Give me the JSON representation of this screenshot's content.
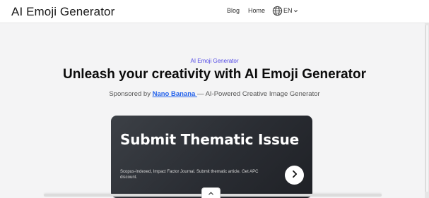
{
  "header": {
    "brand": "AI Emoji Generator",
    "nav": {
      "blog": "Blog",
      "home": "Home"
    },
    "language": {
      "icon": "globe-icon",
      "code": "EN",
      "caret_icon": "chevron-down-icon"
    }
  },
  "hero": {
    "eyebrow": "AI Emoji Generator",
    "headline": "Unleash your creativity with AI Emoji Generator",
    "sponsor": {
      "prefix": "Sponsored by ",
      "link": "Nano Banana ",
      "suffix": "— AI-Powered Creative Image Generator"
    }
  },
  "ad": {
    "title": "Submit Thematic Issue",
    "description": "Scopus-Indexed, Impact Factor Journal. Submit thematic article. Get APC discount.",
    "arrow_icon": "arrow-right-icon"
  },
  "collapse": {
    "icon": "chevron-up-icon"
  },
  "colors": {
    "accent": "#4f46e5",
    "link": "#2563eb",
    "ad_bg": "#2a2d33",
    "page_bg": "#f4f4f5"
  }
}
